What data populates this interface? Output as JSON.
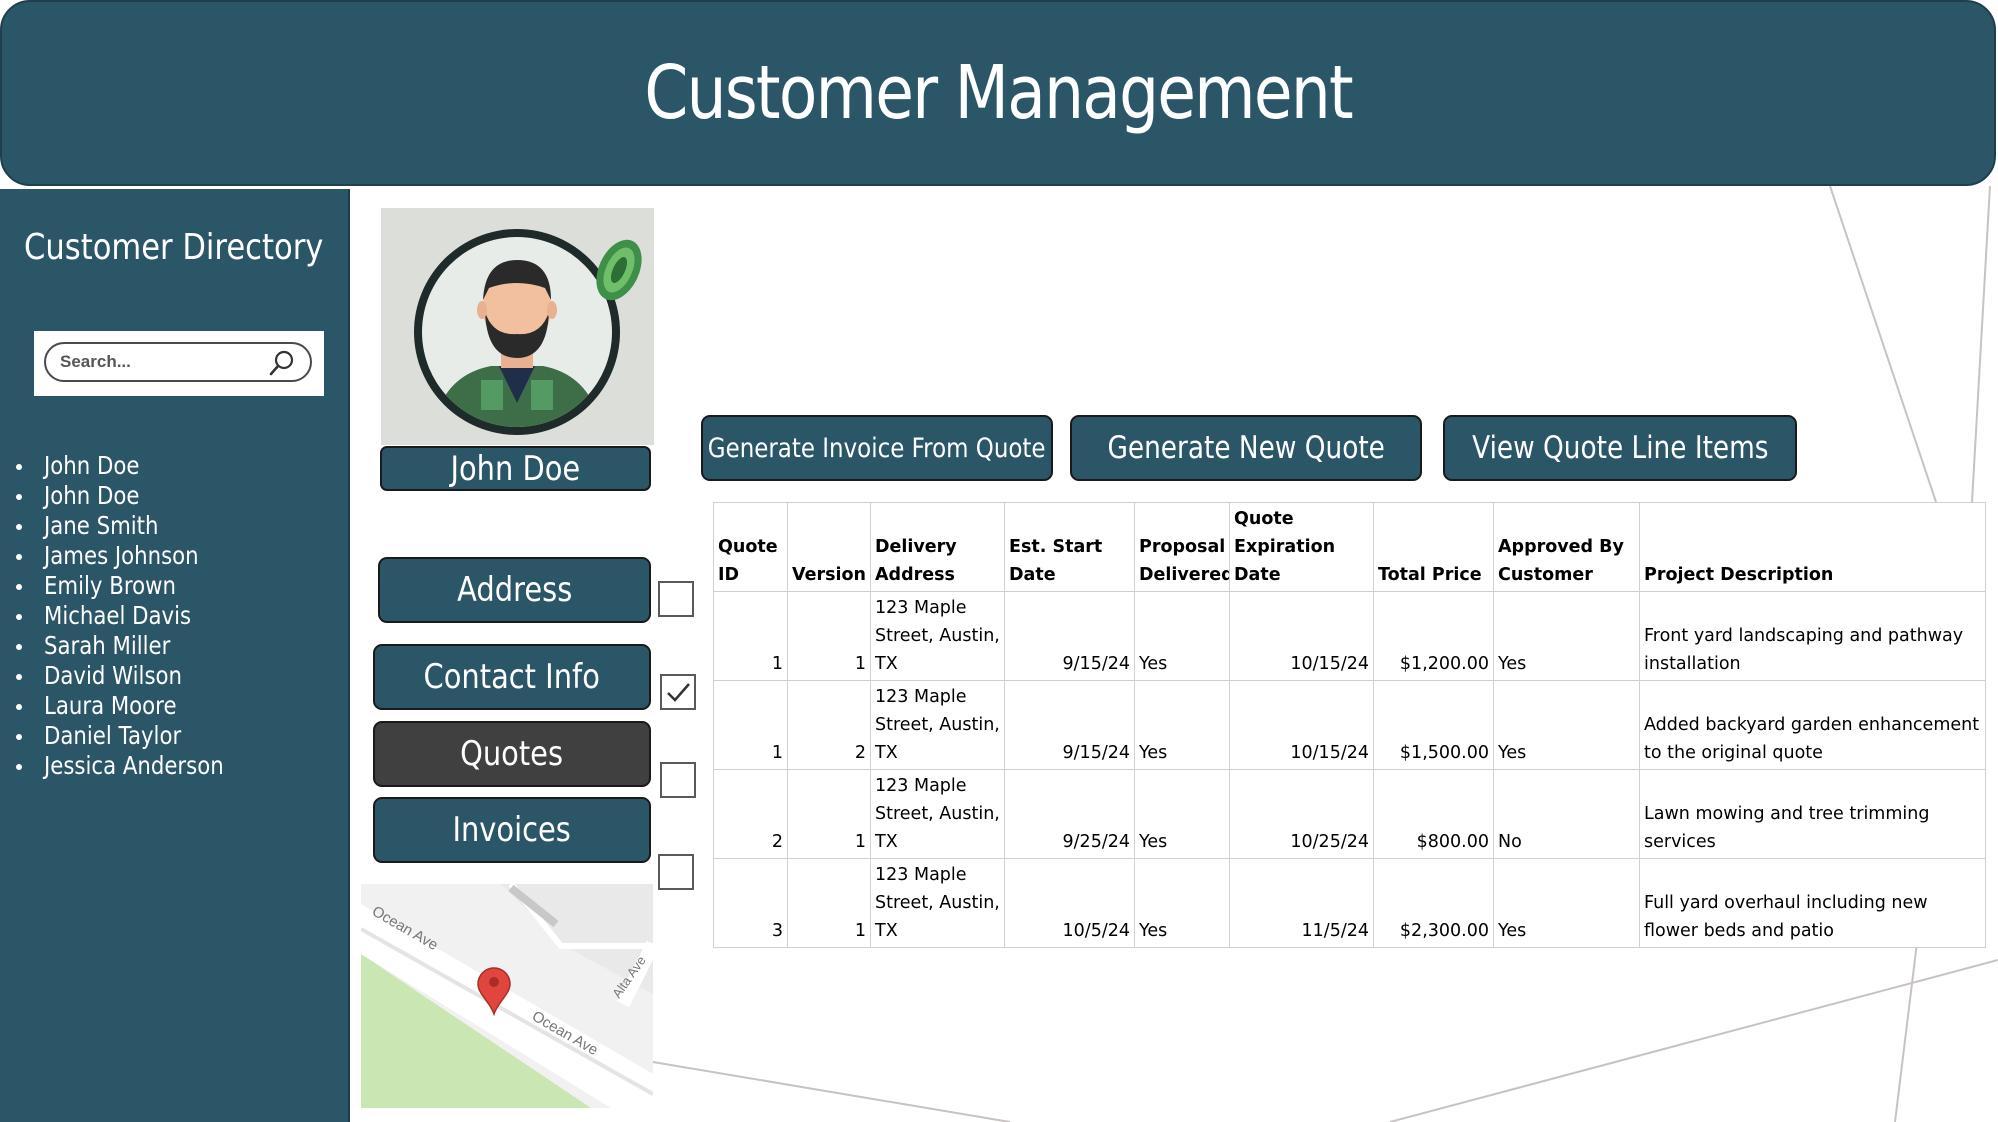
{
  "header": {
    "title": "Customer Management"
  },
  "sidebar": {
    "title": "Customer Directory",
    "search_placeholder": "Search...",
    "customers": [
      "John Doe",
      "John Doe",
      "Jane Smith",
      "James Johnson",
      "Emily Brown",
      "Michael Davis",
      "Sarah Miller",
      "David Wilson",
      "Laura Moore",
      "Daniel Taylor",
      "Jessica Anderson"
    ]
  },
  "profile": {
    "name": "John Doe"
  },
  "nav": {
    "address": "Address",
    "contact_info": "Contact Info",
    "quotes": "Quotes",
    "invoices": "Invoices",
    "active": "Quotes",
    "checked": [
      false,
      true,
      false,
      false
    ]
  },
  "map": {
    "street1": "Ocean Ave",
    "street2": "Ocean Ave",
    "street3": "Alta Ave"
  },
  "actions": {
    "generate_invoice": "Generate Invoice From Quote",
    "generate_quote": "Generate New Quote",
    "view_line_items": "View Quote Line Items"
  },
  "table": {
    "headers": [
      "Quote ID",
      "Version",
      "Delivery Address",
      "Est. Start Date",
      "Proposal Delivered",
      "Quote Expiration Date",
      "Total Price",
      "Approved By Customer",
      "Project Description"
    ],
    "rows": [
      [
        "1",
        "1",
        "123 Maple Street, Austin, TX",
        "9/15/24",
        "Yes",
        "10/15/24",
        "$1,200.00",
        "Yes",
        "Front yard landscaping and pathway installation"
      ],
      [
        "1",
        "2",
        "123 Maple Street, Austin, TX",
        "9/15/24",
        "Yes",
        "10/15/24",
        "$1,500.00",
        "Yes",
        "Added backyard garden enhancement to the original quote"
      ],
      [
        "2",
        "1",
        "123 Maple Street, Austin, TX",
        "9/25/24",
        "Yes",
        "10/25/24",
        "$800.00",
        "No",
        "Lawn mowing and tree trimming services"
      ],
      [
        "3",
        "1",
        "123 Maple Street, Austin, TX",
        "10/5/24",
        "Yes",
        "11/5/24",
        "$2,300.00",
        "Yes",
        "Full yard overhaul including new flower beds and patio"
      ]
    ]
  },
  "colors": {
    "primary": "#2b5668",
    "active_nav": "#404040",
    "border": "#1a1a1a"
  }
}
